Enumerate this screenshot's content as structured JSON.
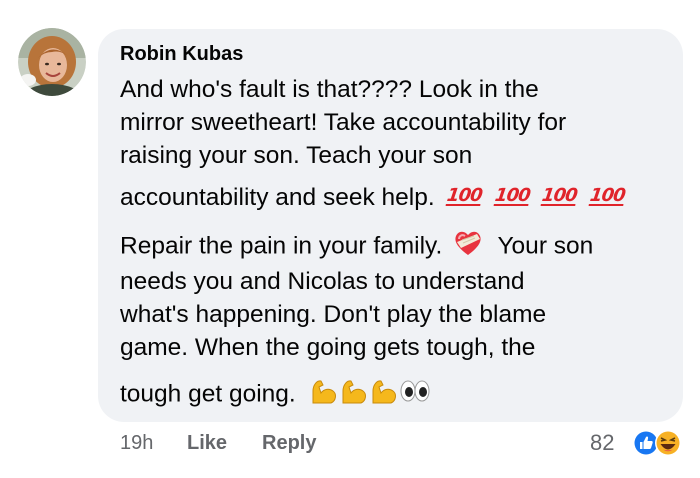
{
  "comment": {
    "author": "Robin Kubas",
    "lines": [
      "And who's fault is that???? Look in the",
      "mirror sweetheart! Take accountability for",
      "raising your son. Teach your son",
      "accountability and seek help.",
      "Repair the pain in your family.",
      "Your son",
      "needs you and Nicolas to understand",
      "what's happening. Don't play the blame",
      "game. When the going gets tough, the",
      "tough get going."
    ],
    "hundred_emoji_text": "100",
    "emoji": {
      "hundred": "hundred-points-emoji",
      "heart": "mending-heart-emoji",
      "muscle": "flexed-biceps-emoji",
      "eyes": "eyes-emoji"
    }
  },
  "actions": {
    "time": "19h",
    "like": "Like",
    "reply": "Reply"
  },
  "reactions": {
    "count": "82",
    "types": [
      "like",
      "haha"
    ],
    "colors": {
      "like": "#1877f2",
      "haha": "#f7b125"
    }
  },
  "colors": {
    "bubble": "#f0f2f5",
    "text": "#050505",
    "meta": "#65676b"
  }
}
